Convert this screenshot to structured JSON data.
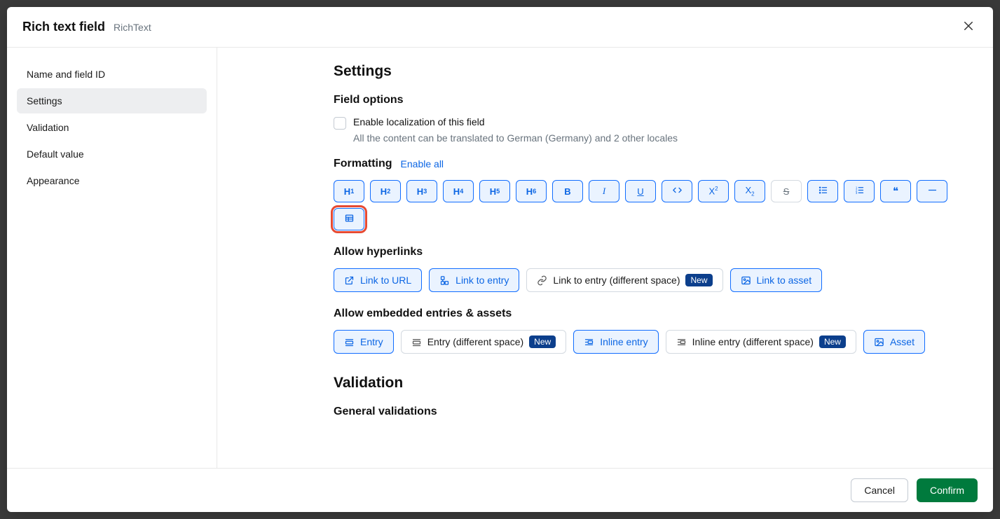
{
  "header": {
    "title": "Rich text field",
    "subtitle": "RichText"
  },
  "sidebar": {
    "items": [
      {
        "label": "Name and field ID"
      },
      {
        "label": "Settings"
      },
      {
        "label": "Validation"
      },
      {
        "label": "Default value"
      },
      {
        "label": "Appearance"
      }
    ]
  },
  "settings": {
    "title": "Settings",
    "field_options_title": "Field options",
    "localization_label": "Enable localization of this field",
    "localization_hint": "All the content can be translated to German (Germany) and 2 other locales",
    "formatting_title": "Formatting",
    "enable_all": "Enable all",
    "hyperlinks_title": "Allow hyperlinks",
    "hyperlinks": {
      "link_url": "Link to URL",
      "link_entry": "Link to entry",
      "link_entry_diff": "Link to entry (different space)",
      "link_asset": "Link to asset",
      "badge_new": "New"
    },
    "embed_title": "Allow embedded entries & assets",
    "embeds": {
      "entry": "Entry",
      "entry_diff": "Entry (different space)",
      "inline_entry": "Inline entry",
      "inline_entry_diff": "Inline entry (different space)",
      "asset": "Asset",
      "badge_new": "New"
    }
  },
  "validation": {
    "title": "Validation",
    "general_title": "General validations"
  },
  "footer": {
    "cancel": "Cancel",
    "confirm": "Confirm"
  }
}
